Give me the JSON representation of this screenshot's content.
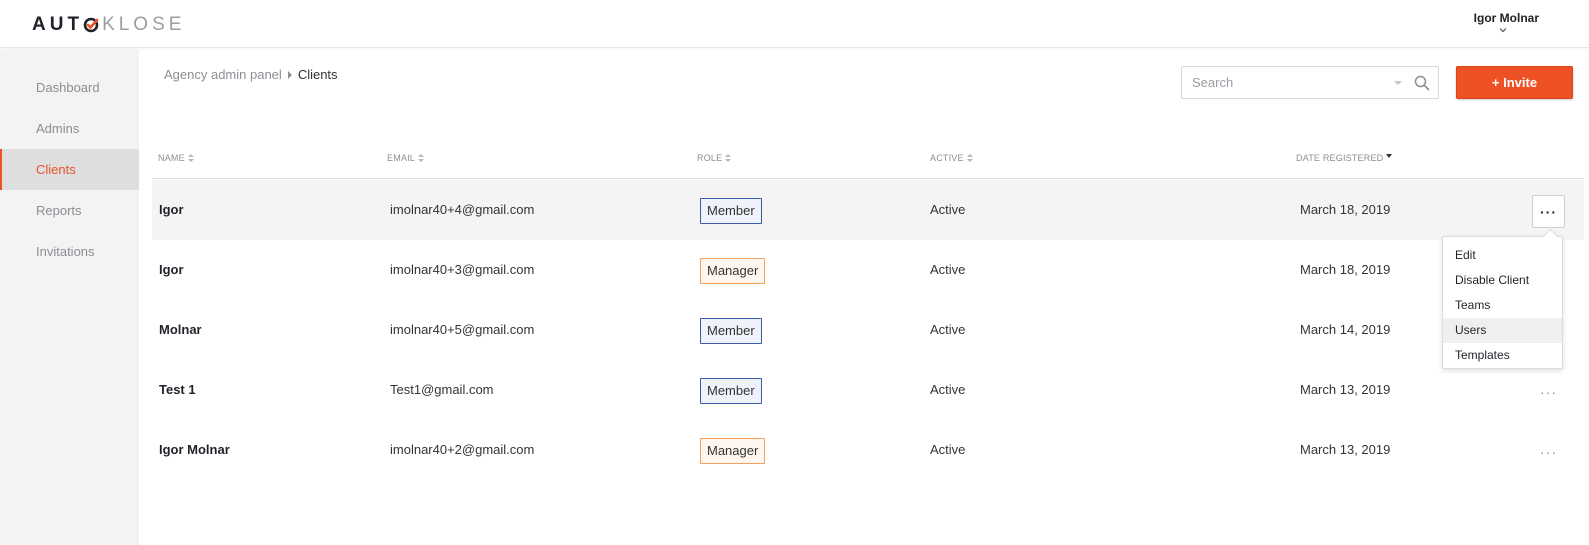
{
  "header": {
    "logo_dark": "AUT",
    "logo_dark2": "",
    "logo_light": "KLOSE",
    "user_name": "Igor Molnar",
    "brand_color": "#ed5124"
  },
  "sidebar": {
    "items": [
      {
        "label": "Dashboard"
      },
      {
        "label": "Admins"
      },
      {
        "label": "Clients",
        "active": true
      },
      {
        "label": "Reports"
      },
      {
        "label": "Invitations"
      }
    ]
  },
  "breadcrumb": {
    "parent": "Agency admin panel",
    "current": "Clients"
  },
  "search": {
    "placeholder": "Search",
    "value": ""
  },
  "invite_label": "+ Invite",
  "table": {
    "headers": {
      "name": "NAME",
      "email": "EMAIL",
      "role": "ROLE",
      "active": "ACTIVE",
      "date": "DATE REGISTERED"
    },
    "rows": [
      {
        "name": "Igor",
        "email": "imolnar40+4@gmail.com",
        "role": "Member",
        "active": "Active",
        "date": "March 18, 2019",
        "more": "···"
      },
      {
        "name": "Igor",
        "email": "imolnar40+3@gmail.com",
        "role": "Manager",
        "active": "Active",
        "date": "March 18, 2019",
        "more": "···"
      },
      {
        "name": "Molnar",
        "email": "imolnar40+5@gmail.com",
        "role": "Member",
        "active": "Active",
        "date": "March 14, 2019",
        "more": "···"
      },
      {
        "name": "Test 1",
        "email": "Test1@gmail.com",
        "role": "Member",
        "active": "Active",
        "date": "March 13, 2019",
        "more": "···"
      },
      {
        "name": "Igor Molnar",
        "email": "imolnar40+2@gmail.com",
        "role": "Manager",
        "active": "Active",
        "date": "March 13, 2019",
        "more": "···"
      }
    ]
  },
  "row_menu": {
    "items": [
      {
        "label": "Edit"
      },
      {
        "label": "Disable Client"
      },
      {
        "label": "Teams"
      },
      {
        "label": "Users"
      },
      {
        "label": "Templates"
      }
    ]
  }
}
